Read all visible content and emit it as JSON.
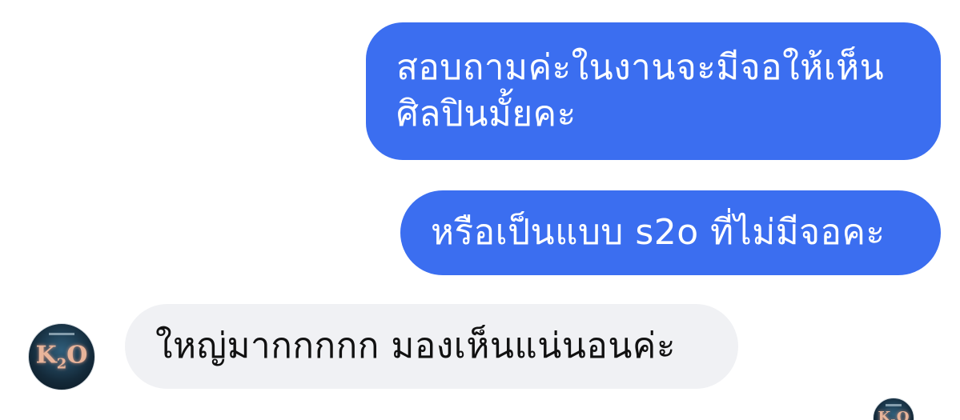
{
  "messages": [
    {
      "direction": "outgoing",
      "lines": [
        "สอบถามค่ะในงานจะมีจอให้เห็น",
        "ศิลปินมั้ยคะ"
      ]
    },
    {
      "direction": "outgoing",
      "text": "หรือเป็นแบบ s2o ที่ไม่มีจอคะ"
    },
    {
      "direction": "incoming",
      "text": "ใหญ่มากกกกก มองเห็นแน่นอนค่ะ"
    }
  ],
  "avatar": {
    "icon": "k2o-logo-avatar"
  },
  "colors": {
    "outgoing_bubble": "#3b6ef0",
    "incoming_bubble": "#f0f1f4"
  }
}
